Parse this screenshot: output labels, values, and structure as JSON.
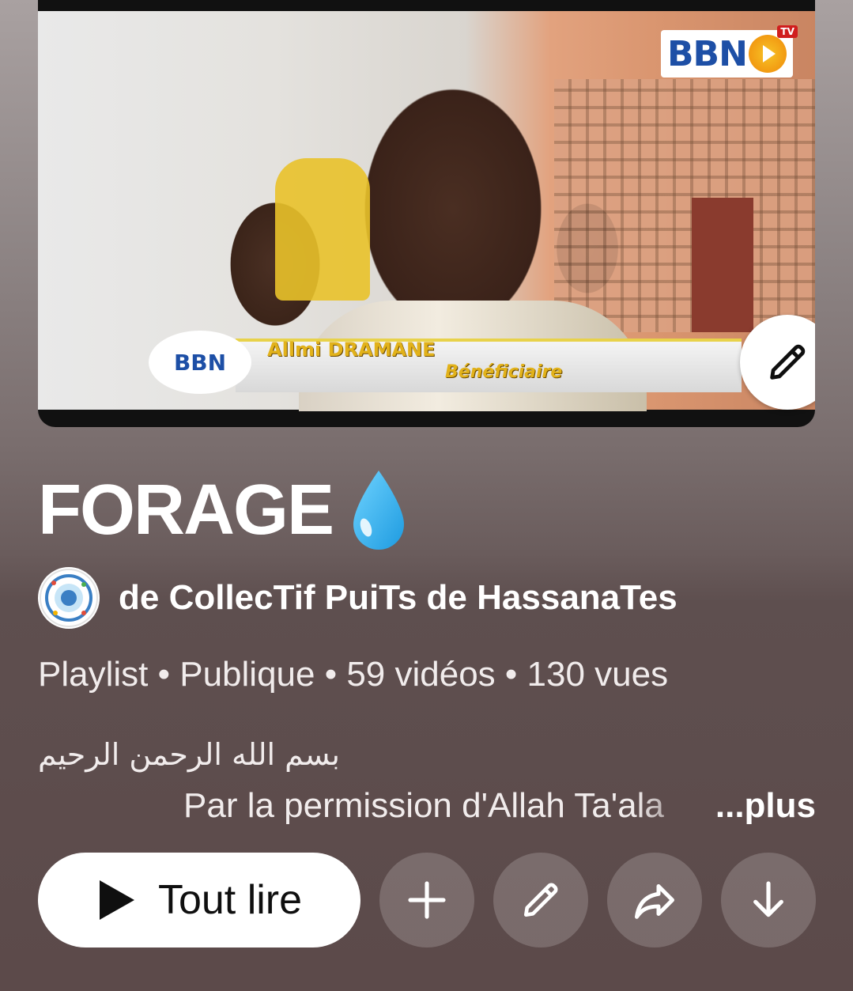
{
  "thumbnail": {
    "channel_logo_text": "BBN",
    "channel_logo_badge": "TV",
    "lower_third_logo": "BBN",
    "person_name": "Allmi DRAMANE",
    "person_role": "Bénéficiaire",
    "edit_icon": "pencil-icon"
  },
  "playlist": {
    "title": "FORAGE",
    "title_emoji": "💧",
    "channel_prefix": "de CollecTif PuiTs de HassanaTes",
    "avatar_icon": "channel-avatar",
    "meta": "Playlist • Publique • 59 vidéos • 130 vues",
    "description_line1": "بسم الله الرحمن الرحيم",
    "description_line2": "Par la permission d'Allah Ta'ala",
    "more_label": "...plus"
  },
  "actions": {
    "play_all_label": "Tout lire",
    "play_icon": "play-icon",
    "add_icon": "plus-icon",
    "edit_icon": "pencil-icon",
    "share_icon": "share-icon",
    "download_icon": "download-icon"
  },
  "colors": {
    "background_top": "#a9a1a1",
    "background_bottom": "#5c4a4a",
    "primary_button_bg": "#ffffff",
    "secondary_button_bg": "rgba(255,255,255,0.18)",
    "logo_blue": "#1d4fa6",
    "lower_third_text": "#e2b21a"
  }
}
